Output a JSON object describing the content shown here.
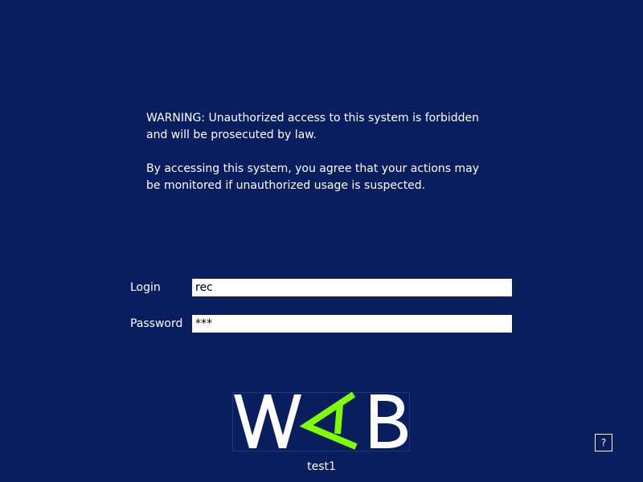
{
  "warning": {
    "line1": "WARNING: Unauthorized access to this system is forbidden",
    "line2": "and will be prosecuted by law.",
    "line3": "By accessing this system, you agree that your actions may",
    "line4": "be monitored if unauthorized usage is suspected."
  },
  "login": {
    "label": "Login",
    "value": "rec"
  },
  "password": {
    "label": "Password",
    "value": "***"
  },
  "logo": {
    "text": "WAB",
    "icon": "wab-logo",
    "letter_color": "#ffffff",
    "accent_color": "#7fff00"
  },
  "hostname": "test1",
  "help": {
    "label": "?",
    "icon": "help-icon"
  },
  "colors": {
    "background": "#081e5f",
    "text": "#ffffff",
    "input_background": "#ffffff",
    "input_text": "#000000"
  }
}
